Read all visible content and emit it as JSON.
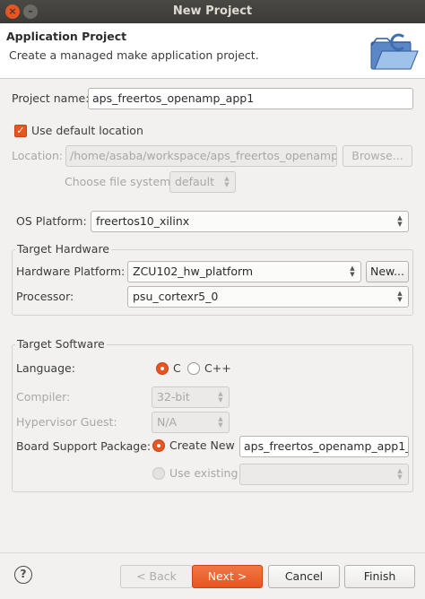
{
  "window": {
    "title": "New Project",
    "close_glyph": "×",
    "min_glyph": "–"
  },
  "header": {
    "title": "Application Project",
    "description": "Create a managed make application project.",
    "icon": "wizard-folder-c-icon"
  },
  "project": {
    "name_label": "Project name:",
    "name_value": "aps_freertos_openamp_app1"
  },
  "location": {
    "use_default_label": "Use default location",
    "use_default_checked": true,
    "location_label": "Location:",
    "location_value": "/home/asaba/workspace/aps_freertos_openamp_",
    "browse_label": "Browse...",
    "file_system_label": "Choose file system:",
    "file_system_value": "default"
  },
  "os": {
    "label": "OS Platform:",
    "value": "freertos10_xilinx"
  },
  "hardware": {
    "group_title": "Target Hardware",
    "platform_label": "Hardware Platform:",
    "platform_value": "ZCU102_hw_platform",
    "new_label": "New...",
    "processor_label": "Processor:",
    "processor_value": "psu_cortexr5_0"
  },
  "software": {
    "group_title": "Target Software",
    "language_label": "Language:",
    "lang_c": "C",
    "lang_cpp": "C++",
    "lang_selected": "C",
    "compiler_label": "Compiler:",
    "compiler_value": "32-bit",
    "hypervisor_label": "Hypervisor Guest:",
    "hypervisor_value": "N/A",
    "bsp_label": "Board Support Package:",
    "create_new_label": "Create New",
    "create_new_value": "aps_freertos_openamp_app1_",
    "use_existing_label": "Use existing",
    "use_existing_value": ""
  },
  "footer": {
    "help_glyph": "?",
    "back_label": "< Back",
    "next_label": "Next >",
    "cancel_label": "Cancel",
    "finish_label": "Finish"
  },
  "colors": {
    "accent": "#e95420",
    "titlebar": "#3c3b37",
    "background": "#f2f1f0"
  }
}
